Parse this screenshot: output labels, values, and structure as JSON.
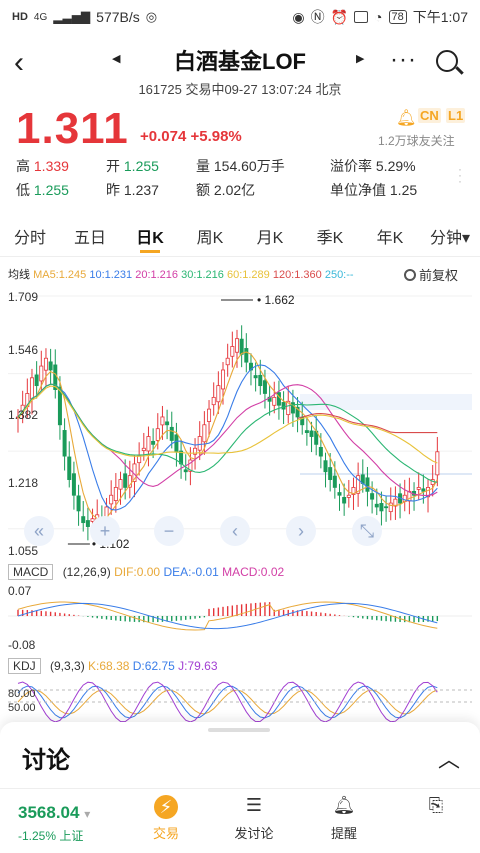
{
  "status_bar": {
    "left_badge": "HD",
    "net_type": "4G",
    "speed": "577B/s",
    "battery": "78",
    "time": "下午1:07"
  },
  "header": {
    "title": "白酒基金LOF",
    "subtitle": "161725 交易中09-27 13:07:24 北京",
    "more": "···"
  },
  "quote": {
    "price": "1.311",
    "change": "+0.074 +5.98%",
    "tag_cn": "CN",
    "tag_l1": "L1",
    "followers": "1.2万球友关注",
    "stats": [
      {
        "label": "高",
        "value": "1.339",
        "color": "red"
      },
      {
        "label": "开",
        "value": "1.255",
        "color": "green"
      },
      {
        "label": "量",
        "value": "154.60万手",
        "color": "plain"
      },
      {
        "label": "溢价率",
        "value": "5.29%",
        "color": "plain"
      },
      {
        "label": "低",
        "value": "1.255",
        "color": "green"
      },
      {
        "label": "昨",
        "value": "1.237",
        "color": "plain"
      },
      {
        "label": "额",
        "value": "2.02亿",
        "color": "plain"
      },
      {
        "label": "单位净值",
        "value": "1.25",
        "color": "plain"
      }
    ]
  },
  "tabs": [
    "分时",
    "五日",
    "日K",
    "周K",
    "月K",
    "季K",
    "年K",
    "分钟▾"
  ],
  "active_tab": "日K",
  "ma_legend": {
    "label": "均线",
    "items": [
      {
        "text": "MA5:1.245",
        "color": "#e8a93a"
      },
      {
        "text": "10:1.231",
        "color": "#3a7de8"
      },
      {
        "text": "20:1.216",
        "color": "#d23fa6"
      },
      {
        "text": "30:1.216",
        "color": "#2bb673"
      },
      {
        "text": "60:1.289",
        "color": "#e8c23a"
      },
      {
        "text": "120:1.360",
        "color": "#d94c4c"
      },
      {
        "text": "250:--",
        "color": "#3ab8d9"
      }
    ],
    "fuquan": "前复权"
  },
  "chart_data": {
    "type": "candlestick",
    "y_ticks": [
      "1.709",
      "1.546",
      "1.382",
      "1.218",
      "1.055"
    ],
    "ylim": [
      1.055,
      1.709
    ],
    "annotations": [
      {
        "text": "1.662",
        "kind": "high"
      },
      {
        "text": "1.102",
        "kind": "low"
      }
    ],
    "closes": [
      1.4,
      1.43,
      1.46,
      1.5,
      1.48,
      1.53,
      1.55,
      1.52,
      1.47,
      1.38,
      1.3,
      1.24,
      1.2,
      1.16,
      1.13,
      1.12,
      1.14,
      1.15,
      1.13,
      1.17,
      1.2,
      1.22,
      1.24,
      1.22,
      1.25,
      1.28,
      1.3,
      1.32,
      1.35,
      1.33,
      1.37,
      1.4,
      1.38,
      1.34,
      1.31,
      1.28,
      1.26,
      1.29,
      1.32,
      1.35,
      1.38,
      1.42,
      1.45,
      1.48,
      1.52,
      1.55,
      1.58,
      1.6,
      1.56,
      1.54,
      1.52,
      1.5,
      1.48,
      1.46,
      1.44,
      1.45,
      1.43,
      1.42,
      1.44,
      1.41,
      1.4,
      1.38,
      1.36,
      1.35,
      1.33,
      1.3,
      1.26,
      1.24,
      1.22,
      1.2,
      1.18,
      1.2,
      1.22,
      1.25,
      1.23,
      1.21,
      1.19,
      1.17,
      1.16,
      1.17,
      1.18,
      1.19,
      1.18,
      1.2,
      1.21,
      1.2,
      1.22,
      1.21,
      1.22,
      1.24,
      1.311
    ],
    "ma_lines": [
      {
        "name": "MA5",
        "color": "#e8a93a"
      },
      {
        "name": "MA10",
        "color": "#3a7de8"
      },
      {
        "name": "MA20",
        "color": "#d23fa6"
      },
      {
        "name": "MA30",
        "color": "#2bb673"
      },
      {
        "name": "MA60",
        "color": "#e8c23a"
      },
      {
        "name": "MA120",
        "color": "#d94c4c"
      }
    ]
  },
  "chart_controls": [
    "«",
    "+",
    "−",
    "‹",
    "›",
    "⤡"
  ],
  "macd": {
    "label": "MACD",
    "params": "(12,26,9)",
    "dif": "DIF:0.00",
    "dea": "DEA:-0.01",
    "macd": "MACD:0.02",
    "y_top": "0.07",
    "y_bottom": "-0.08"
  },
  "kdj": {
    "label": "KDJ",
    "params": "(9,3,3)",
    "k": "K:68.38",
    "d": "D:62.75",
    "j": "J:79.63",
    "y_top": "80.00",
    "y_mid": "50.00"
  },
  "discussion": {
    "title": "讨论",
    "caret": "^"
  },
  "bottom_bar": {
    "index_value": "3568.04",
    "index_arrow": "▾",
    "index_change": "-1.25% 上证",
    "nav": [
      {
        "label": "交易",
        "icon": "trade-icon",
        "active": true
      },
      {
        "label": "发讨论",
        "icon": "post-icon",
        "active": false
      },
      {
        "label": "提醒",
        "icon": "bell-icon",
        "active": false
      },
      {
        "label": "",
        "icon": "share-icon",
        "active": false
      }
    ]
  },
  "colors": {
    "up": "#e5363a",
    "down": "#1a9b5a",
    "accent": "#f5a623"
  }
}
